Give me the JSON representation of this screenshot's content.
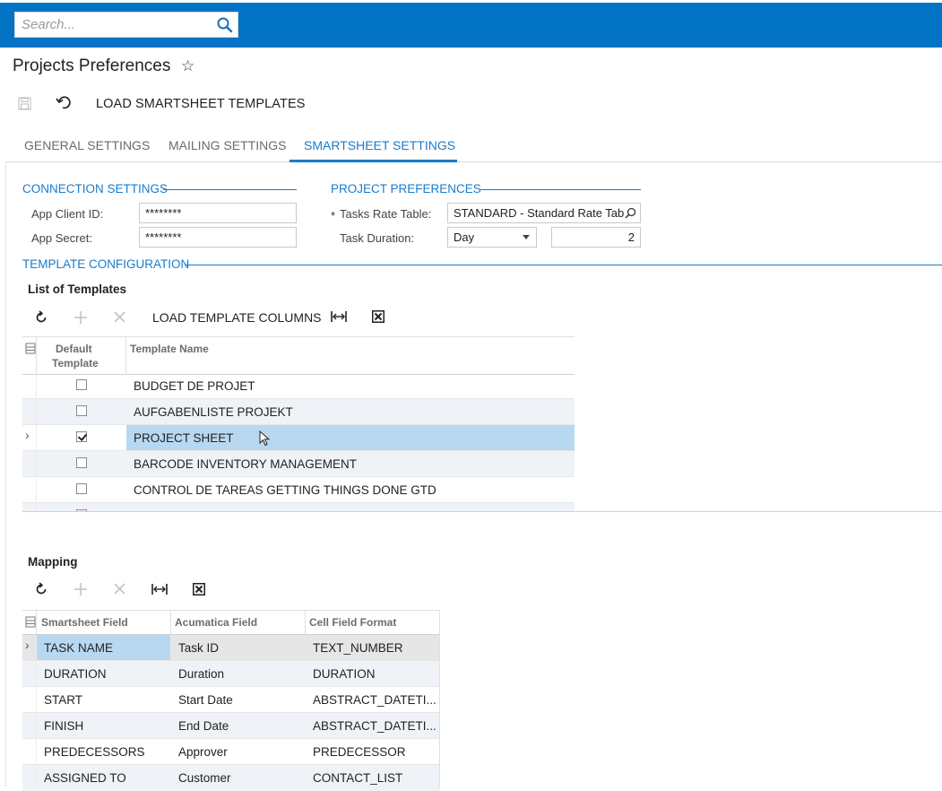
{
  "search": {
    "placeholder": "Search..."
  },
  "page": {
    "title": "Projects Preferences"
  },
  "toolbar": {
    "load_smartsheet_templates": "LOAD SMARTSHEET TEMPLATES"
  },
  "tabs": [
    {
      "label": "GENERAL SETTINGS",
      "active": false
    },
    {
      "label": "MAILING SETTINGS",
      "active": false
    },
    {
      "label": "SMARTSHEET SETTINGS",
      "active": true
    }
  ],
  "connection": {
    "heading": "CONNECTION SETTINGS",
    "client_id_label": "App Client ID:",
    "client_id_value": "********",
    "secret_label": "App Secret:",
    "secret_value": "********"
  },
  "preferences": {
    "heading": "PROJECT PREFERENCES",
    "required_mark": "*",
    "rate_table_label": "Tasks Rate Table:",
    "rate_table_value": "STANDARD - Standard Rate Tab",
    "duration_label": "Task Duration:",
    "duration_unit": "Day",
    "duration_value": "2"
  },
  "template_config": {
    "heading": "TEMPLATE CONFIGURATION"
  },
  "templates": {
    "title": "List of Templates",
    "load_columns_label": "LOAD TEMPLATE COLUMNS",
    "columns": {
      "default_line1": "Default",
      "default_line2": "Template",
      "name": "Template Name"
    },
    "rows": [
      {
        "default": false,
        "name": "BUDGET DE PROJET"
      },
      {
        "default": false,
        "name": "AUFGABENLISTE PROJEKT"
      },
      {
        "default": true,
        "name": "PROJECT SHEET",
        "selected": true
      },
      {
        "default": false,
        "name": "BARCODE INVENTORY MANAGEMENT"
      },
      {
        "default": false,
        "name": "CONTROL DE TAREAS GETTING THINGS DONE GTD"
      }
    ]
  },
  "mapping": {
    "title": "Mapping",
    "columns": {
      "smartsheet": "Smartsheet Field",
      "acumatica": "Acumatica Field",
      "format": "Cell Field Format"
    },
    "rows": [
      {
        "smartsheet": "TASK NAME",
        "acumatica": "Task ID",
        "format": "TEXT_NUMBER",
        "selected": true
      },
      {
        "smartsheet": "DURATION",
        "acumatica": "Duration",
        "format": "DURATION"
      },
      {
        "smartsheet": "START",
        "acumatica": "Start Date",
        "format": "ABSTRACT_DATETI..."
      },
      {
        "smartsheet": "FINISH",
        "acumatica": "End Date",
        "format": "ABSTRACT_DATETI..."
      },
      {
        "smartsheet": "PREDECESSORS",
        "acumatica": "Approver",
        "format": "PREDECESSOR"
      },
      {
        "smartsheet": "ASSIGNED TO",
        "acumatica": "Customer",
        "format": "CONTACT_LIST"
      }
    ]
  },
  "colors": {
    "brand": "#0373c6",
    "accent": "#1a7bc9",
    "selected_row": "#b8d8f2",
    "alt_row": "#eff3f7"
  },
  "icons": [
    "search-icon",
    "star-icon",
    "save-icon",
    "undo-icon",
    "refresh-icon",
    "add-icon",
    "delete-icon",
    "fit-columns-icon",
    "excel-export-icon",
    "column-settings-icon",
    "row-expander-icon",
    "mouse-cursor-icon",
    "dropdown-arrow-icon",
    "lookup-search-icon"
  ]
}
